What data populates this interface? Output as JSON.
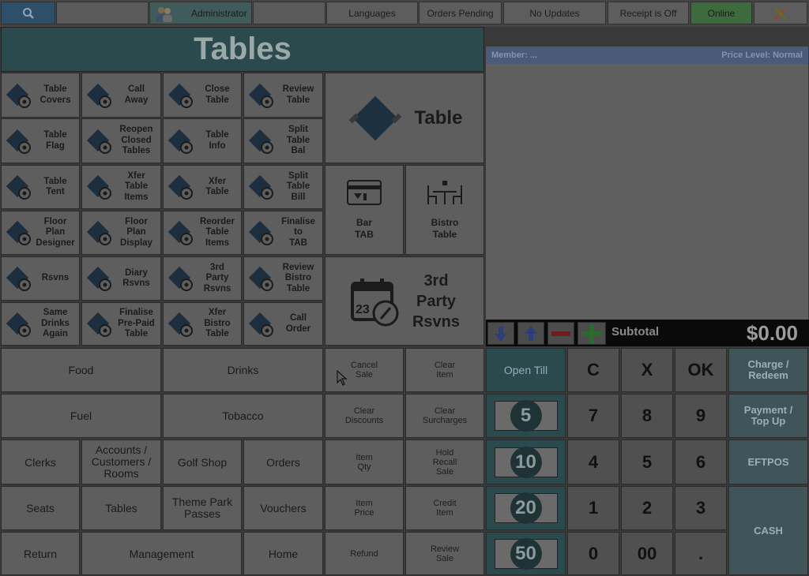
{
  "topbar": {
    "search_icon": "magnifier-icon",
    "user": "Administrator",
    "languages": "Languages",
    "orders_pending": "Orders Pending",
    "no_updates": "No Updates",
    "receipt": "Receipt is Off",
    "online": "Online"
  },
  "title": "Tables",
  "functions": [
    {
      "label": "Table\nCovers",
      "icon": "table-covers-icon"
    },
    {
      "label": "Call\nAway",
      "icon": "bell-icon"
    },
    {
      "label": "Close\nTable",
      "icon": "close-table-icon"
    },
    {
      "label": "Review\nTable",
      "icon": "review-table-icon"
    },
    {
      "label": "Table\nFlag",
      "icon": "table-flag-icon"
    },
    {
      "label": "Reopen\nClosed\nTables",
      "icon": "reopen-table-icon"
    },
    {
      "label": "Table\nInfo",
      "icon": "table-info-icon"
    },
    {
      "label": "Split\nTable\nBal",
      "icon": "split-balance-icon"
    },
    {
      "label": "Table\nTent",
      "icon": "table-tent-icon"
    },
    {
      "label": "Xfer\nTable\nItems",
      "icon": "transfer-items-icon"
    },
    {
      "label": "Xfer\nTable",
      "icon": "transfer-table-icon"
    },
    {
      "label": "Split\nTable\nBill",
      "icon": "split-bill-icon"
    },
    {
      "label": "Floor\nPlan\nDesigner",
      "icon": "floor-plan-designer-icon"
    },
    {
      "label": "Floor\nPlan\nDisplay",
      "icon": "floor-plan-display-icon"
    },
    {
      "label": "Reorder\nTable\nItems",
      "icon": "reorder-items-icon"
    },
    {
      "label": "Finalise\nto\nTAB",
      "icon": "finalise-tab-icon"
    },
    {
      "label": "Rsvns",
      "icon": "calendar-icon"
    },
    {
      "label": "Diary\nRsvns",
      "icon": "diary-calendar-icon"
    },
    {
      "label": "3rd\nParty\nRsvns",
      "icon": "third-party-calendar-icon"
    },
    {
      "label": "Review\nBistro\nTable",
      "icon": "review-bistro-icon"
    },
    {
      "label": "Same\nDrinks\nAgain",
      "icon": "drinks-icon"
    },
    {
      "label": "Finalise\nPre-Paid\nTable",
      "icon": "prepaid-table-icon"
    },
    {
      "label": "Xfer\nBistro\nTable",
      "icon": "transfer-bistro-icon"
    },
    {
      "label": "Call\nOrder",
      "icon": "phone-icon"
    }
  ],
  "big": {
    "table": "Table",
    "bar_tab": "Bar\nTAB",
    "bistro_table": "Bistro\nTable",
    "third_party": "3rd\nParty\nRsvns"
  },
  "categories": {
    "food": "Food",
    "drinks": "Drinks",
    "fuel": "Fuel",
    "tobacco": "Tobacco",
    "clerks": "Clerks",
    "accounts": "Accounts /\nCustomers /\nRooms",
    "golf": "Golf Shop",
    "orders": "Orders",
    "seats": "Seats",
    "tables": "Tables",
    "theme_park": "Theme Park\nPasses",
    "vouchers": "Vouchers",
    "return": "Return",
    "management": "Management",
    "home": "Home"
  },
  "actions": {
    "cancel_sale": "Cancel\nSale",
    "clear_item": "Clear\nItem",
    "clear_discounts": "Clear\nDiscounts",
    "clear_surcharges": "Clear\nSurcharges",
    "item_qty": "Item\nQty",
    "hold_recall": "Hold\nRecall\nSale",
    "item_price": "Item\nPrice",
    "credit_item": "Credit\nItem",
    "refund": "Refund",
    "review_sale": "Review\nSale"
  },
  "receipt": {
    "member": "Member: ...",
    "price_level": "Price Level: Normal",
    "subtotal_label": "Subtotal",
    "subtotal_value": "$0.00"
  },
  "keypad": {
    "open_till": "Open Till",
    "clear": "C",
    "x": "X",
    "ok": "OK",
    "keys": [
      "7",
      "8",
      "9",
      "4",
      "5",
      "6",
      "1",
      "2",
      "3",
      "0",
      "00",
      "."
    ],
    "notes": [
      "5",
      "10",
      "20",
      "50"
    ]
  },
  "payments": {
    "charge": "Charge /\nRedeem",
    "payment": "Payment /\nTop Up",
    "eftpos": "EFTPOS",
    "cash": "CASH"
  },
  "colors": {
    "online": "#3d6b3d",
    "accent": "#2a4a4e",
    "selection": "#4a5a78"
  }
}
